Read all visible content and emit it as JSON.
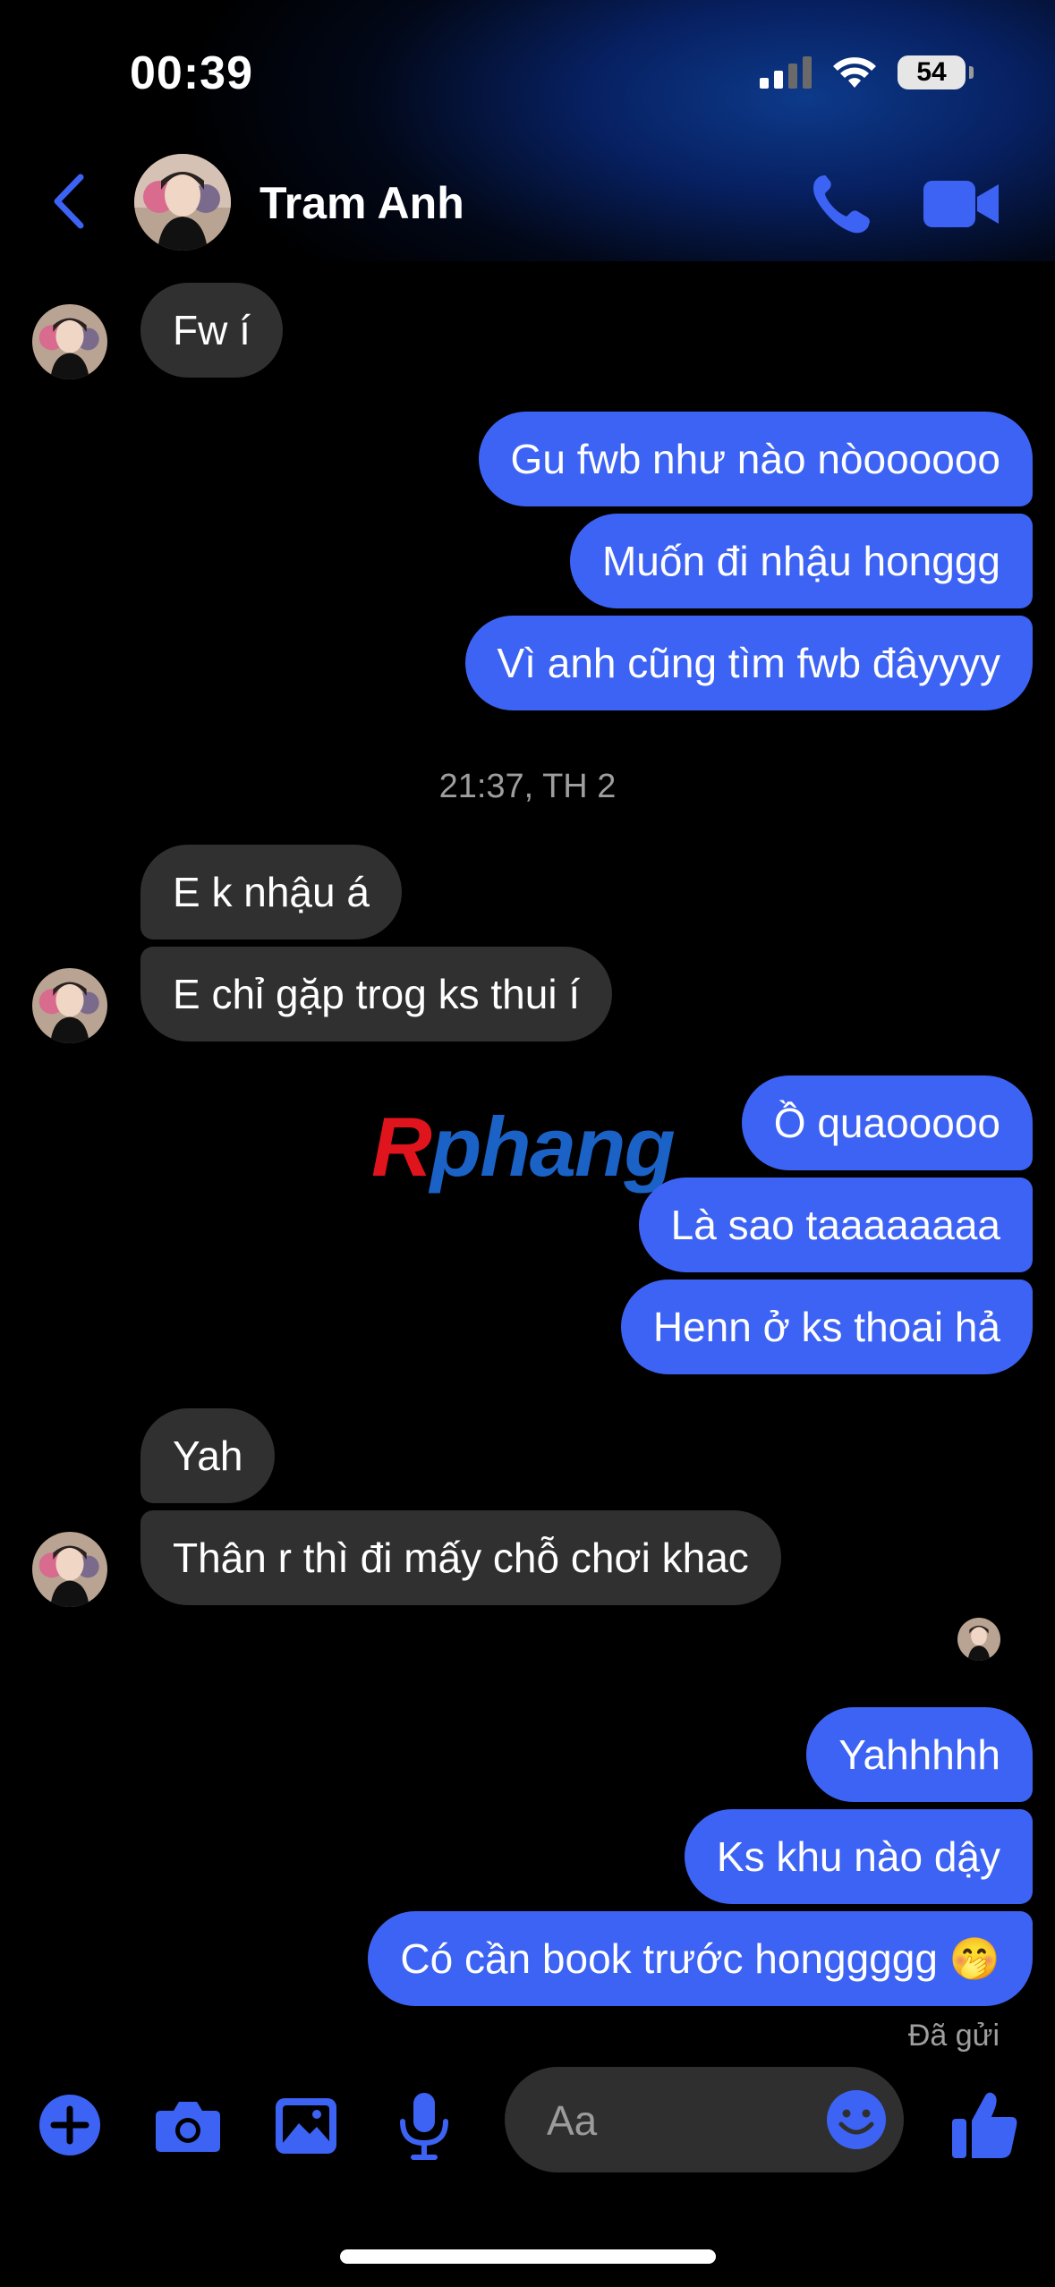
{
  "status_bar": {
    "time": "00:39",
    "battery_level": "54"
  },
  "header": {
    "contact_name": "Tram Anh",
    "back_icon": "chevron-left-icon",
    "call_icon": "phone-icon",
    "video_icon": "video-camera-icon"
  },
  "messages": {
    "m1": "Fw í",
    "m2": "Gu fwb như nào nòoooooo",
    "m3": "Muốn đi nhậu honggg",
    "m4": "Vì anh cũng tìm fwb đâyyyy",
    "timestamp": "21:37, TH 2",
    "m5": "E k nhậu á",
    "m6": "E chỉ gặp trog ks thui í",
    "m7": "Ồ quaooooo",
    "m8": "Là sao taaaaaaaa",
    "m9": "Henn ở ks thoai hả",
    "m10": "Yah",
    "m11": "Thân r thì đi mấy chỗ chơi khac",
    "m12": "Yahhhhh",
    "m13": "Ks khu nào dậy",
    "m14": "Có cần book trước honggggg",
    "m14_emoji": "🤭",
    "sent_status": "Đã gửi"
  },
  "watermark": {
    "r": "R",
    "rest": "phang"
  },
  "composer": {
    "placeholder": "Aa"
  },
  "toolbar_icons": [
    "plus-icon",
    "camera-icon",
    "image-icon",
    "microphone-icon",
    "emoji-icon",
    "thumbs-up-icon"
  ],
  "colors": {
    "accent": "#3d63f4",
    "incoming_bubble": "#303030",
    "background": "#000000"
  }
}
